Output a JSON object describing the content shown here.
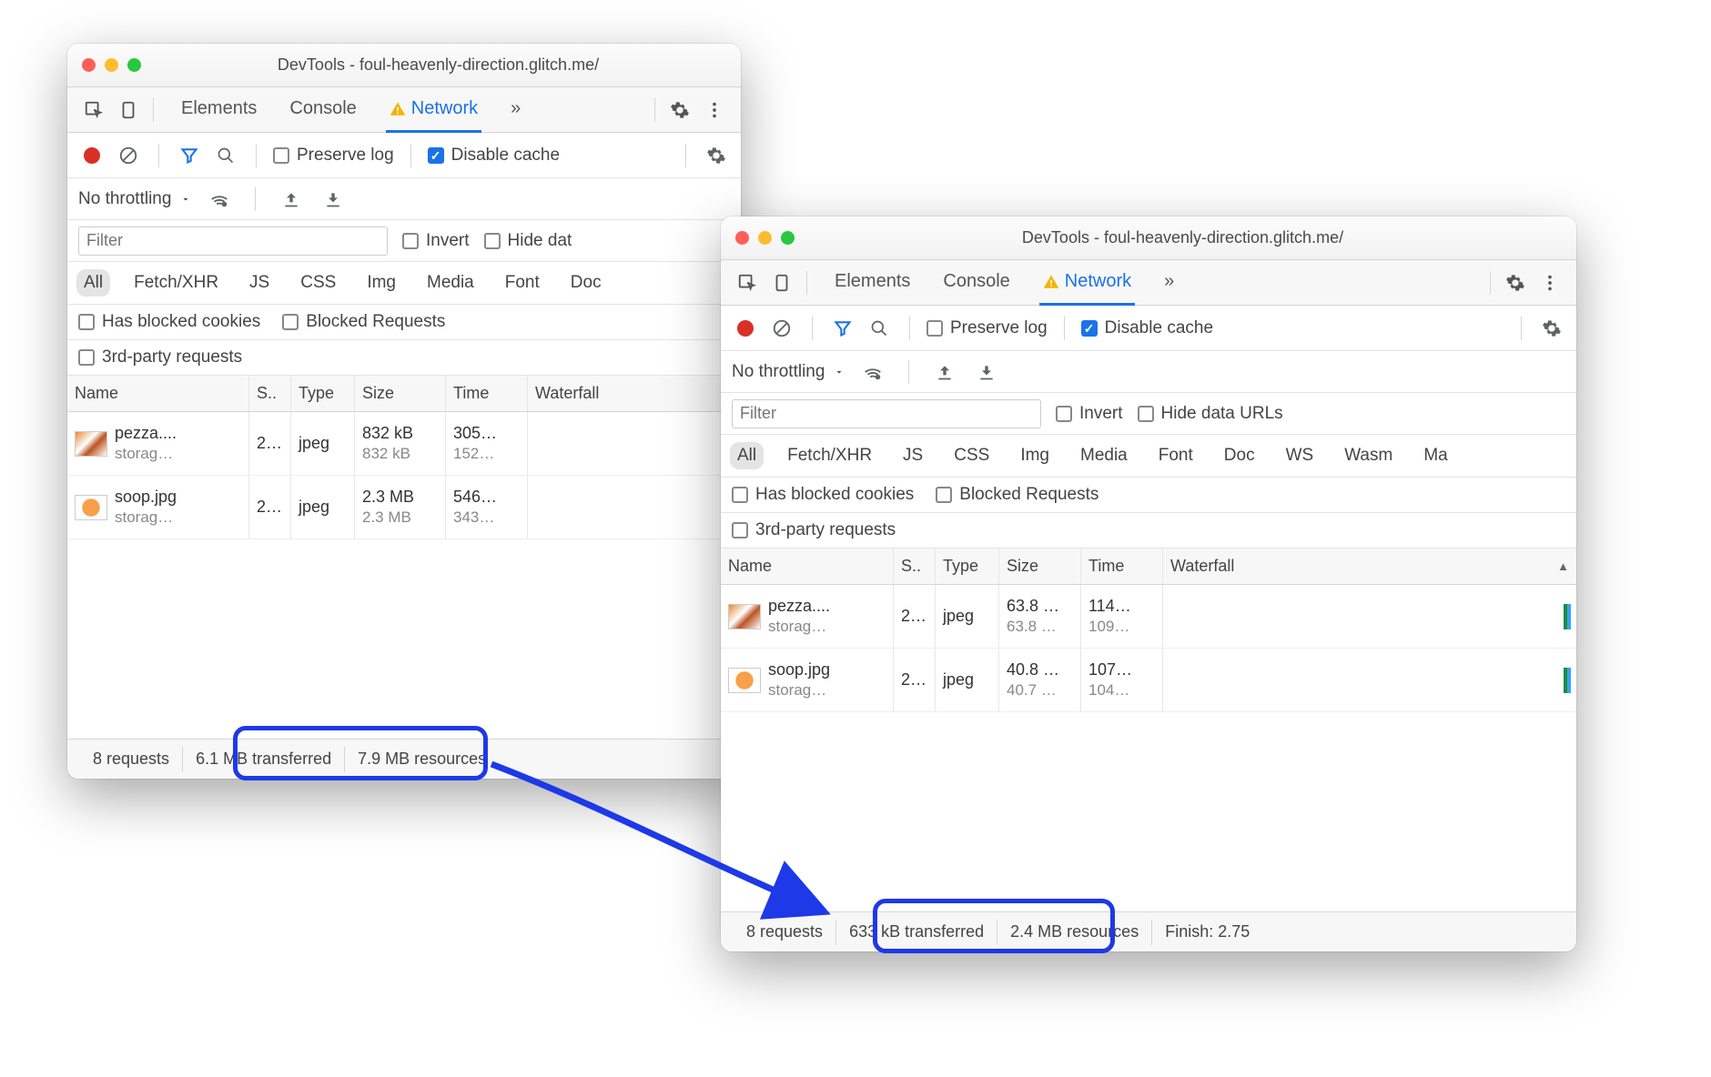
{
  "windows": [
    {
      "id": "w1",
      "title": "DevTools - foul-heavenly-direction.glitch.me/",
      "tabs": {
        "elements": "Elements",
        "console": "Console",
        "network": "Network",
        "more": "»"
      },
      "toolbar": {
        "preserve_log": "Preserve log",
        "disable_cache": "Disable cache"
      },
      "throttle": {
        "label": "No throttling"
      },
      "filter": {
        "placeholder": "Filter",
        "invert": "Invert",
        "hide_data": "Hide dat"
      },
      "types": [
        "All",
        "Fetch/XHR",
        "JS",
        "CSS",
        "Img",
        "Media",
        "Font",
        "Doc"
      ],
      "flags": {
        "blocked_cookies": "Has blocked cookies",
        "blocked_req": "Blocked Requests",
        "third_party": "3rd-party requests"
      },
      "columns": {
        "name": "Name",
        "status": "S..",
        "type": "Type",
        "size": "Size",
        "time": "Time",
        "waterfall": "Waterfall"
      },
      "rows": [
        {
          "name": "pezza....",
          "sub": "storag…",
          "status": "2…",
          "type": "jpeg",
          "size1": "832 kB",
          "size2": "832 kB",
          "time1": "305…",
          "time2": "152…"
        },
        {
          "name": "soop.jpg",
          "sub": "storag…",
          "status": "2…",
          "type": "jpeg",
          "size1": "2.3 MB",
          "size2": "2.3 MB",
          "time1": "546…",
          "time2": "343…"
        }
      ],
      "status": {
        "requests": "8 requests",
        "transferred": "6.1 MB transferred",
        "resources": "7.9 MB resources"
      }
    },
    {
      "id": "w2",
      "title": "DevTools - foul-heavenly-direction.glitch.me/",
      "tabs": {
        "elements": "Elements",
        "console": "Console",
        "network": "Network",
        "more": "»"
      },
      "toolbar": {
        "preserve_log": "Preserve log",
        "disable_cache": "Disable cache"
      },
      "throttle": {
        "label": "No throttling"
      },
      "filter": {
        "placeholder": "Filter",
        "invert": "Invert",
        "hide_data": "Hide data URLs"
      },
      "types": [
        "All",
        "Fetch/XHR",
        "JS",
        "CSS",
        "Img",
        "Media",
        "Font",
        "Doc",
        "WS",
        "Wasm",
        "Ma"
      ],
      "flags": {
        "blocked_cookies": "Has blocked cookies",
        "blocked_req": "Blocked Requests",
        "third_party": "3rd-party requests"
      },
      "columns": {
        "name": "Name",
        "status": "S..",
        "type": "Type",
        "size": "Size",
        "time": "Time",
        "waterfall": "Waterfall"
      },
      "rows": [
        {
          "name": "pezza....",
          "sub": "storag…",
          "status": "2…",
          "type": "jpeg",
          "size1": "63.8 …",
          "size2": "63.8 …",
          "time1": "114…",
          "time2": "109…"
        },
        {
          "name": "soop.jpg",
          "sub": "storag…",
          "status": "2…",
          "type": "jpeg",
          "size1": "40.8 …",
          "size2": "40.7 …",
          "time1": "107…",
          "time2": "104…"
        }
      ],
      "status": {
        "requests": "8 requests",
        "transferred": "633 kB transferred",
        "resources": "2.4 MB resources",
        "finish": "Finish: 2.75"
      }
    }
  ]
}
